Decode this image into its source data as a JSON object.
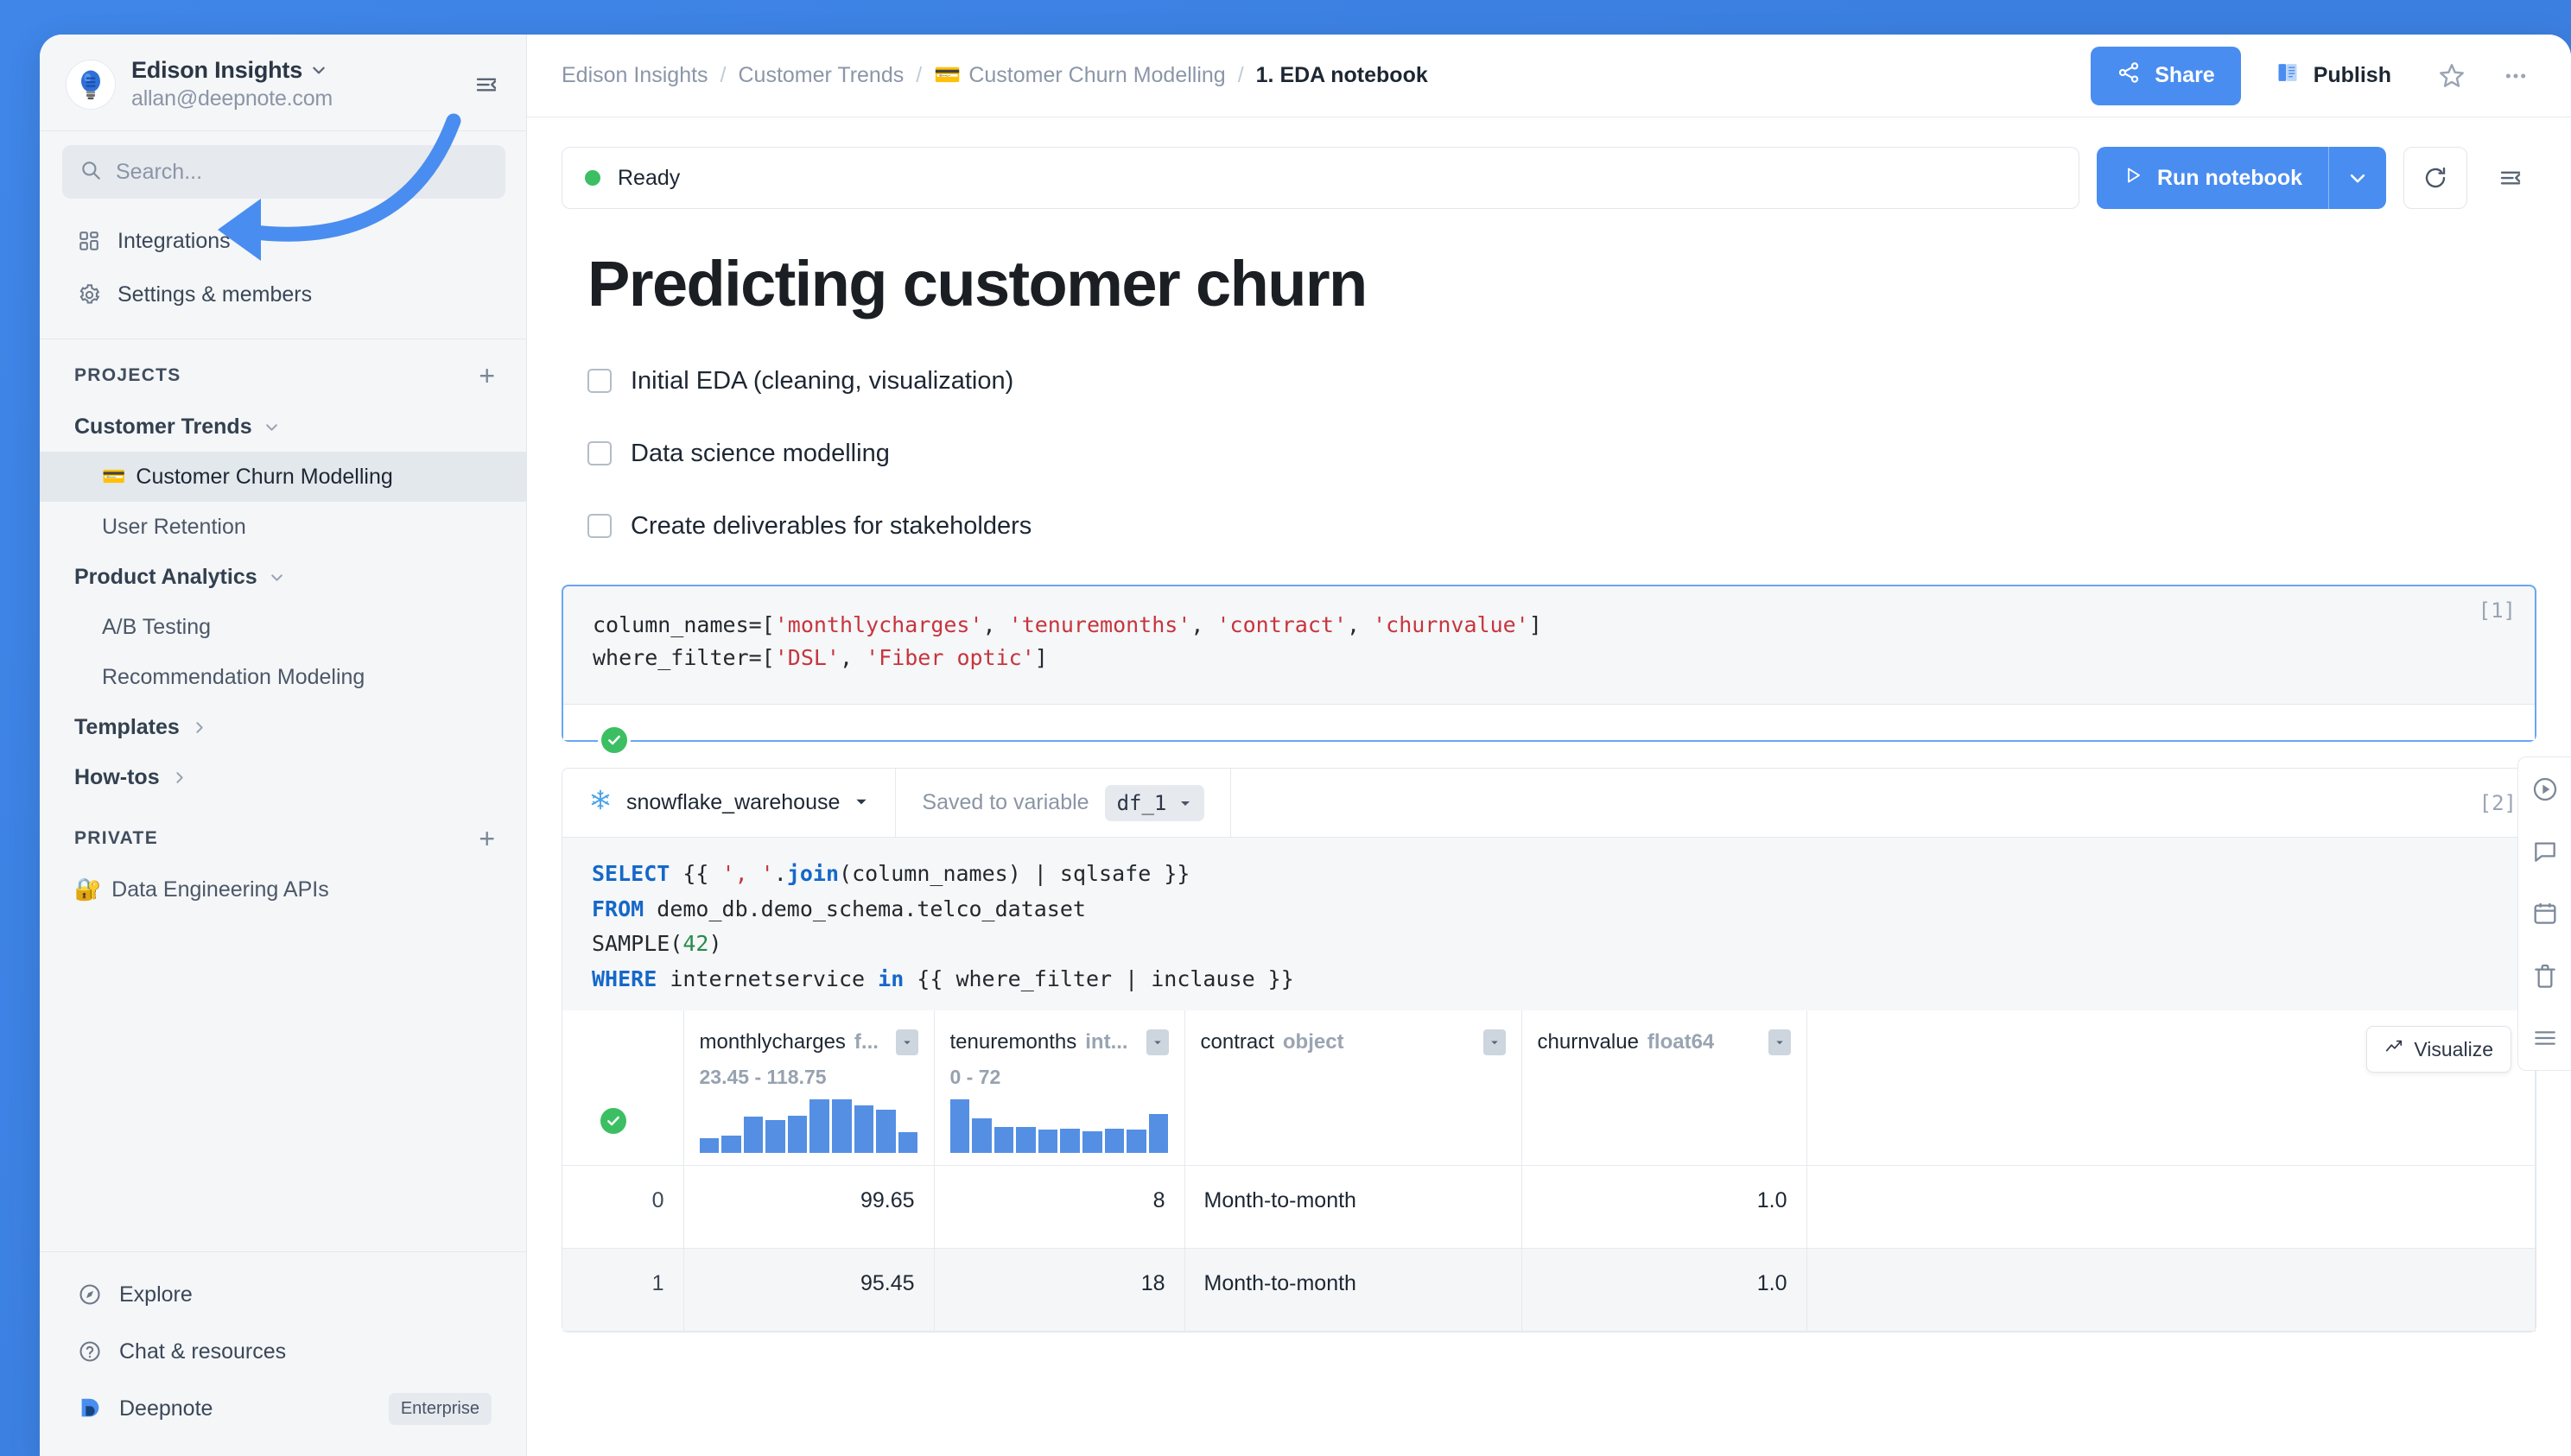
{
  "workspace": {
    "name": "Edison Insights",
    "email": "allan@deepnote.com",
    "avatar_icon": "lightbulb-icon",
    "caret_icon": "chevron-down-icon",
    "collapse_icon": "collapse-sidebar-icon"
  },
  "search": {
    "placeholder": "Search...",
    "icon": "search-icon"
  },
  "nav": [
    {
      "label": "Integrations",
      "icon": "integrations-icon"
    },
    {
      "label": "Settings & members",
      "icon": "gear-icon"
    }
  ],
  "projects_section": {
    "title": "PROJECTS",
    "add_label": "+"
  },
  "projects": [
    {
      "label": "Customer Trends",
      "type": "group",
      "expanded": true,
      "children": [
        {
          "label": "Customer Churn Modelling",
          "emoji": "💳",
          "active": true
        },
        {
          "label": "User Retention",
          "emoji": "",
          "active": false
        }
      ]
    },
    {
      "label": "Product Analytics",
      "type": "group",
      "expanded": true,
      "children": [
        {
          "label": "A/B Testing",
          "emoji": "",
          "active": false
        },
        {
          "label": "Recommendation Modeling",
          "emoji": "",
          "active": false
        }
      ]
    }
  ],
  "flat_groups": [
    {
      "label": "Templates",
      "chevron": "chevron-right-icon"
    },
    {
      "label": "How-tos",
      "chevron": "chevron-right-icon"
    }
  ],
  "private_section": {
    "title": "PRIVATE",
    "add_label": "+"
  },
  "private_items": [
    {
      "label": "Data Engineering APIs",
      "emoji": "🔐"
    }
  ],
  "sidebar_footer": [
    {
      "label": "Explore",
      "icon": "compass-icon"
    },
    {
      "label": "Chat & resources",
      "icon": "question-circle-icon"
    },
    {
      "label": "Deepnote",
      "icon": "deepnote-logo-icon",
      "badge": "Enterprise"
    }
  ],
  "breadcrumb": {
    "items": [
      {
        "label": "Edison Insights",
        "emoji": "",
        "current": false
      },
      {
        "label": "Customer Trends",
        "emoji": "",
        "current": false
      },
      {
        "label": "Customer Churn Modelling",
        "emoji": "💳",
        "current": false
      },
      {
        "label": "1. EDA notebook",
        "emoji": "",
        "current": true
      }
    ],
    "separator": "/"
  },
  "topbar": {
    "share_label": "Share",
    "share_icon": "share-icon",
    "publish_label": "Publish",
    "publish_icon": "book-icon",
    "star_icon": "star-icon",
    "more_icon": "more-horizontal-icon"
  },
  "runbar": {
    "status_text": "Ready",
    "status_color": "#3cbf63",
    "run_label": "Run notebook",
    "run_icon": "play-icon",
    "run_caret_icon": "chevron-down-icon",
    "refresh_icon": "refresh-icon",
    "panel_icon": "collapse-panel-icon"
  },
  "notebook": {
    "title": "Predicting customer churn",
    "checklist": [
      {
        "label": "Initial EDA (cleaning, visualization)",
        "checked": false
      },
      {
        "label": "Data science modelling",
        "checked": false
      },
      {
        "label": "Create deliverables for stakeholders",
        "checked": false
      }
    ],
    "cells": [
      {
        "exec_count": "[1]",
        "type": "python",
        "status": "success",
        "code_lines": [
          "column_names=['monthlycharges', 'tenuremonths', 'contract', 'churnvalue']",
          "where_filter=['DSL', 'Fiber optic']"
        ]
      },
      {
        "exec_count": "[2]",
        "type": "sql",
        "status": "success",
        "datasource": "snowflake_warehouse",
        "datasource_icon": "snowflake-icon",
        "saved_to_variable_label": "Saved to variable",
        "variable_name": "df_1",
        "code_lines": [
          "SELECT {{ ', '.join(column_names) | sqlsafe }}",
          "FROM demo_db.demo_schema.telco_dataset",
          "SAMPLE(42)",
          "WHERE internetservice in {{ where_filter | inclause }}"
        ]
      }
    ]
  },
  "result_table": {
    "visualize_label": "Visualize",
    "visualize_icon": "chart-line-icon",
    "columns": [
      {
        "name": "",
        "dtype": "",
        "range": "",
        "histogram": []
      },
      {
        "name": "monthlycharges",
        "dtype": "f...",
        "range": "23.45 - 118.75",
        "histogram": [
          18,
          22,
          44,
          40,
          46,
          66,
          66,
          58,
          53,
          25
        ]
      },
      {
        "name": "tenuremonths",
        "dtype": "int...",
        "range": "0 - 72",
        "histogram": [
          66,
          42,
          32,
          32,
          29,
          30,
          27,
          30,
          29,
          48
        ]
      },
      {
        "name": "contract",
        "dtype": "object",
        "range": "",
        "histogram": []
      },
      {
        "name": "churnvalue",
        "dtype": "float64",
        "range": "",
        "histogram": []
      },
      {
        "name": "",
        "dtype": "",
        "range": "",
        "histogram": []
      }
    ],
    "rows": [
      {
        "index": "0",
        "monthlycharges": "99.65",
        "tenuremonths": "8",
        "contract": "Month-to-month",
        "churnvalue": "1.0"
      },
      {
        "index": "1",
        "monthlycharges": "95.45",
        "tenuremonths": "18",
        "contract": "Month-to-month",
        "churnvalue": "1.0"
      }
    ]
  },
  "right_rail": [
    {
      "icon": "run-cell-icon"
    },
    {
      "icon": "comment-icon"
    },
    {
      "icon": "calendar-icon"
    },
    {
      "icon": "trash-icon"
    },
    {
      "icon": "outline-icon"
    }
  ],
  "annotation": {
    "arrow_color": "#4a8df0",
    "points_to": "PROJECTS"
  },
  "colors": {
    "accent": "#4a8df0",
    "background": "#3b7fe0",
    "sidebar": "#f4f6f8",
    "success": "#3cbf63",
    "string": "#c7353d",
    "keyword": "#1668c9"
  }
}
